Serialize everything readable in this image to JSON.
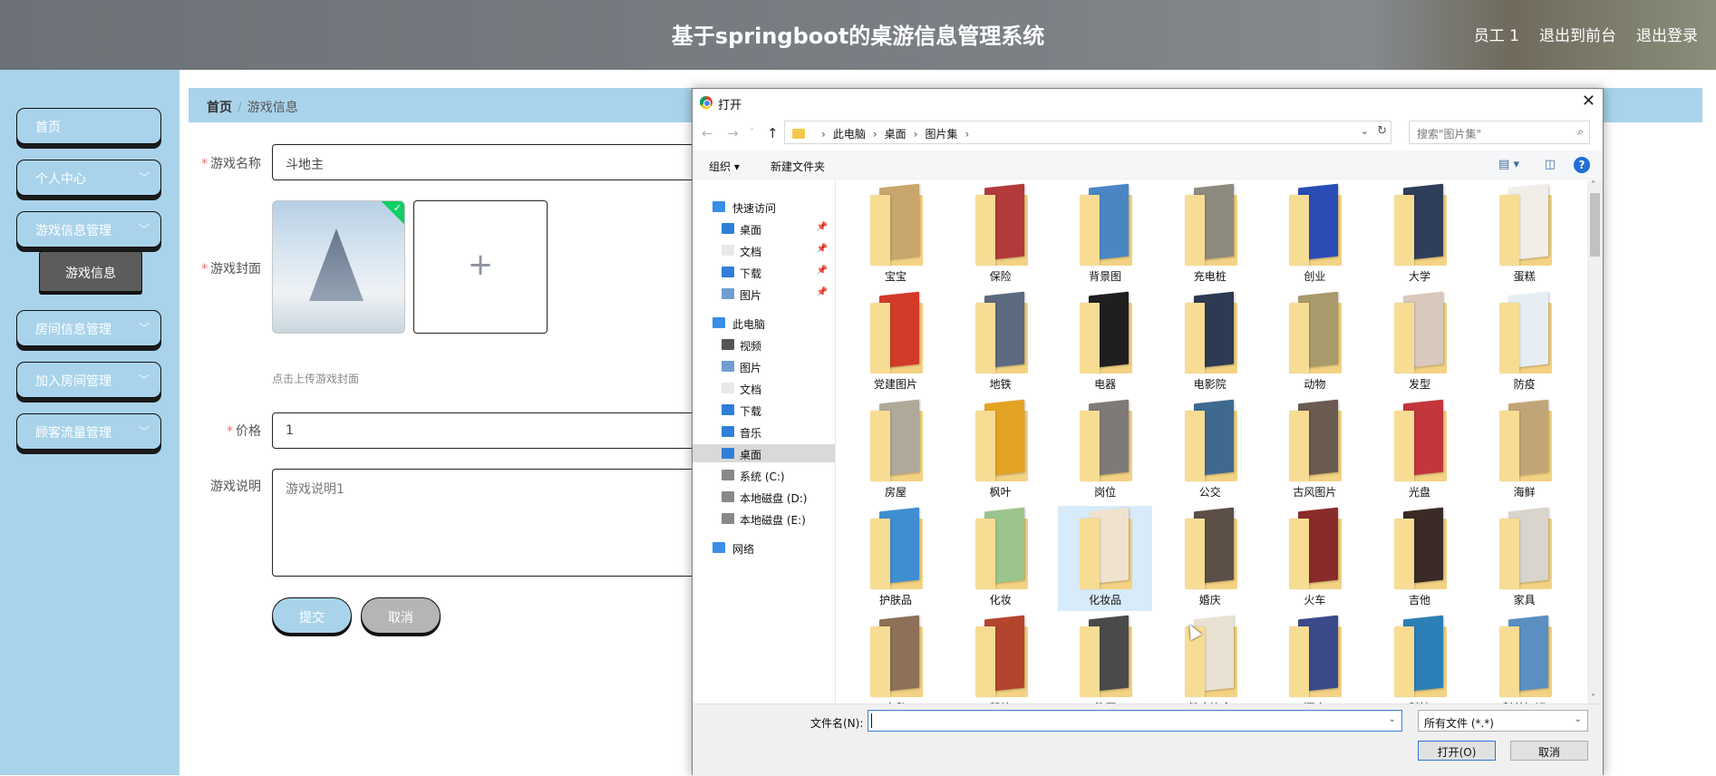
{
  "header": {
    "title": "基于springboot的桌游信息管理系统",
    "user": "员工 1",
    "to_front": "退出到前台",
    "logout": "退出登录"
  },
  "sidebar": {
    "items": [
      {
        "label": "首页",
        "has_arrow": false
      },
      {
        "label": "个人中心",
        "has_arrow": true
      },
      {
        "label": "游戏信息管理",
        "has_arrow": true
      },
      {
        "label": "房间信息管理",
        "has_arrow": true
      },
      {
        "label": "加入房间管理",
        "has_arrow": true
      },
      {
        "label": "顾客流量管理",
        "has_arrow": true
      }
    ],
    "sub_item": "游戏信息"
  },
  "breadcrumb": {
    "home": "首页",
    "current": "游戏信息"
  },
  "form": {
    "name_label": "游戏名称",
    "name_value": "斗地主",
    "cover_label": "游戏封面",
    "upload_plus": "+",
    "upload_hint": "点击上传游戏封面",
    "price_label": "价格",
    "price_value": "1",
    "desc_label": "游戏说明",
    "desc_value": "游戏说明1",
    "submit": "提交",
    "cancel": "取消"
  },
  "dialog": {
    "title": "打开",
    "path": [
      "此电脑",
      "桌面",
      "图片集"
    ],
    "search_placeholder": "搜索\"图片集\"",
    "organize": "组织",
    "new_folder": "新建文件夹",
    "help": "?",
    "nav": [
      {
        "label": "快速访问",
        "icon": "star-icon",
        "level": 0,
        "pinned": false,
        "selected": false
      },
      {
        "label": "桌面",
        "icon": "desktop-icon",
        "level": 1,
        "pinned": true,
        "selected": false
      },
      {
        "label": "文档",
        "icon": "document-icon",
        "level": 1,
        "pinned": true,
        "selected": false
      },
      {
        "label": "下载",
        "icon": "download-icon",
        "level": 1,
        "pinned": true,
        "selected": false
      },
      {
        "label": "图片",
        "icon": "picture-icon",
        "level": 1,
        "pinned": true,
        "selected": false
      },
      {
        "label": "此电脑",
        "icon": "computer-icon",
        "level": 0,
        "pinned": false,
        "selected": false
      },
      {
        "label": "视频",
        "icon": "video-icon",
        "level": 1,
        "pinned": false,
        "selected": false
      },
      {
        "label": "图片",
        "icon": "picture-icon",
        "level": 1,
        "pinned": false,
        "selected": false
      },
      {
        "label": "文档",
        "icon": "document-icon",
        "level": 1,
        "pinned": false,
        "selected": false
      },
      {
        "label": "下载",
        "icon": "download-icon",
        "level": 1,
        "pinned": false,
        "selected": false
      },
      {
        "label": "音乐",
        "icon": "music-icon",
        "level": 1,
        "pinned": false,
        "selected": false
      },
      {
        "label": "桌面",
        "icon": "desktop-icon",
        "level": 1,
        "pinned": false,
        "selected": true
      },
      {
        "label": "系统 (C:)",
        "icon": "drive-icon",
        "level": 1,
        "pinned": false,
        "selected": false
      },
      {
        "label": "本地磁盘 (D:)",
        "icon": "drive-icon",
        "level": 1,
        "pinned": false,
        "selected": false
      },
      {
        "label": "本地磁盘 (E:)",
        "icon": "drive-icon",
        "level": 1,
        "pinned": false,
        "selected": false
      },
      {
        "label": "网络",
        "icon": "network-icon",
        "level": 0,
        "pinned": false,
        "selected": false
      }
    ],
    "folders": [
      {
        "name": "宝宝",
        "color": "#c9a66b"
      },
      {
        "name": "保险",
        "color": "#b23a3a"
      },
      {
        "name": "背景图",
        "color": "#4b86c4"
      },
      {
        "name": "充电桩",
        "color": "#8e8a80"
      },
      {
        "name": "创业",
        "color": "#2a4db5"
      },
      {
        "name": "大学",
        "color": "#2f3e5a"
      },
      {
        "name": "蛋糕",
        "color": "#f1eee8"
      },
      {
        "name": "党建图片",
        "color": "#d23a2a"
      },
      {
        "name": "地铁",
        "color": "#5c6a80"
      },
      {
        "name": "电器",
        "color": "#1f1f1f"
      },
      {
        "name": "电影院",
        "color": "#2e3a52"
      },
      {
        "name": "动物",
        "color": "#a89a6a"
      },
      {
        "name": "发型",
        "color": "#d9c8bd"
      },
      {
        "name": "防疫",
        "color": "#e7eef3"
      },
      {
        "name": "房屋",
        "color": "#b0a99a"
      },
      {
        "name": "枫叶",
        "color": "#e3a424"
      },
      {
        "name": "岗位",
        "color": "#7e7a78"
      },
      {
        "name": "公交",
        "color": "#3f6a8e"
      },
      {
        "name": "古风图片",
        "color": "#6a5a50"
      },
      {
        "name": "光盘",
        "color": "#c2363c"
      },
      {
        "name": "海鲜",
        "color": "#c2a577"
      },
      {
        "name": "护肤品",
        "color": "#3e8ed1"
      },
      {
        "name": "化妆",
        "color": "#9cc48d"
      },
      {
        "name": "化妆品",
        "color": "#efe3cf"
      },
      {
        "name": "婚庆",
        "color": "#5c4f48"
      },
      {
        "name": "火车",
        "color": "#8a2b2b"
      },
      {
        "name": "吉他",
        "color": "#3a2b26"
      },
      {
        "name": "家具",
        "color": "#d9d4cc"
      },
      {
        "name": "家私",
        "color": "#8d7057"
      },
      {
        "name": "驾校",
        "color": "#b3452e"
      },
      {
        "name": "简历",
        "color": "#4a4a4a"
      },
      {
        "name": "健康饮食",
        "color": "#e9e2d2"
      },
      {
        "name": "酒店",
        "color": "#3a4a8a"
      },
      {
        "name": "科技",
        "color": "#2d7fb7"
      },
      {
        "name": "科普知识",
        "color": "#5b8fc2"
      }
    ],
    "file_name_label": "文件名(N):",
    "file_name_value": "",
    "file_type": "所有文件 (*.*)",
    "open": "打开(O)",
    "cancel": "取消"
  }
}
